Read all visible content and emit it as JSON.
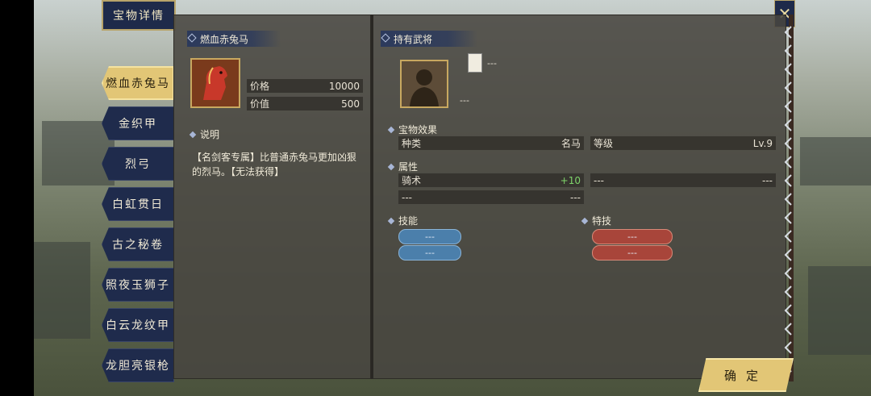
{
  "window_title": "宝物详情",
  "close_symbol": "✕",
  "item_list": [
    {
      "label": "燃血赤兔马",
      "active": true
    },
    {
      "label": "金织甲",
      "active": false
    },
    {
      "label": "烈弓",
      "active": false
    },
    {
      "label": "白虹贯日",
      "active": false
    },
    {
      "label": "古之秘卷",
      "active": false
    },
    {
      "label": "照夜玉狮子",
      "active": false
    },
    {
      "label": "白云龙纹甲",
      "active": false
    },
    {
      "label": "龙胆亮银枪",
      "active": false
    }
  ],
  "item_detail": {
    "name": "燃血赤兔马",
    "price_label": "价格",
    "price_value": "10000",
    "value_label": "价值",
    "value_value": "500",
    "desc_label": "说明",
    "desc_text": "【名剑客专属】比普通赤兔马更加凶狠的烈马。【无法获得】"
  },
  "holder": {
    "header": "持有武将",
    "flag_text": "---",
    "name": "---"
  },
  "effects": {
    "header": "宝物效果",
    "type_label": "种类",
    "type_value": "名马",
    "level_label": "等级",
    "level_value": "Lv.9",
    "attr_header": "属性",
    "attr_rows": [
      {
        "name": "骑术",
        "value": "+10"
      },
      {
        "name": "---",
        "value": "---"
      },
      {
        "name": "---",
        "value": "---"
      }
    ],
    "skills_header": "技能",
    "skills": [
      "---",
      "---"
    ],
    "specials_header": "特技",
    "specials": [
      "---",
      "---"
    ]
  },
  "confirm_label": "确定",
  "colors": {
    "accent_gold": "#e2c676",
    "tab_navy": "#1f2b4c",
    "bonus_green": "#7ed36a",
    "skill_blue": "#4b7fab",
    "special_red": "#a8453a"
  }
}
